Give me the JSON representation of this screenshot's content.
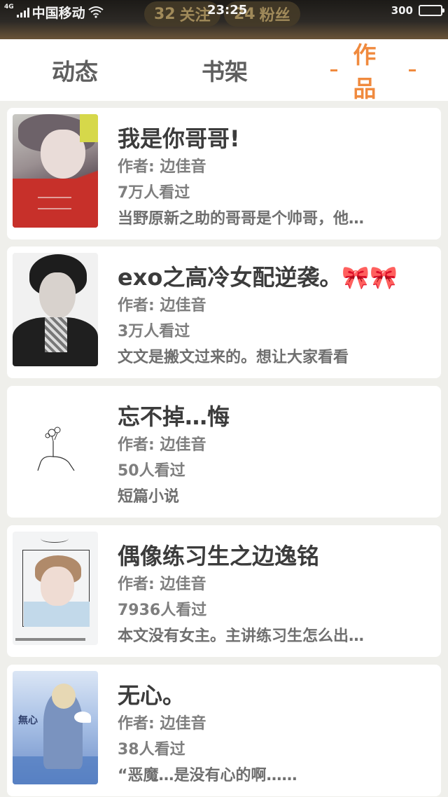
{
  "status_bar": {
    "network": "4G",
    "carrier": "中国移动",
    "time": "23:25",
    "battery_text": "300",
    "battery_level": 0.95,
    "follow_count": "32",
    "follow_label": "关注",
    "fans_count": "24",
    "fans_label": "粉丝"
  },
  "tabs": [
    {
      "label": "动态",
      "active": false
    },
    {
      "label": "书架",
      "active": false
    },
    {
      "label": "作品",
      "active": true
    }
  ],
  "accent_color": "#f08a3e",
  "works": [
    {
      "title": "我是你哥哥!",
      "author": "作者: 边佳音",
      "views": "7万人看过",
      "summary": "当野原新之助的哥哥是个帅哥，他…"
    },
    {
      "title": "exo之高冷女配逆袭。🎀🎀",
      "author": "作者: 边佳音",
      "views": "3万人看过",
      "summary": "文文是搬文过来的。想让大家看看"
    },
    {
      "title": "忘不掉…悔",
      "author": "作者: 边佳音",
      "views": "50人看过",
      "summary": "短篇小说"
    },
    {
      "title": "偶像练习生之边逸铭",
      "author": "作者: 边佳音",
      "views": "7936人看过",
      "summary": "本文没有女主。主讲练习生怎么出…"
    },
    {
      "title": "无心。",
      "author": "作者: 边佳音",
      "views": "38人看过",
      "summary": "“恶魔…是没有心的啊……"
    }
  ]
}
